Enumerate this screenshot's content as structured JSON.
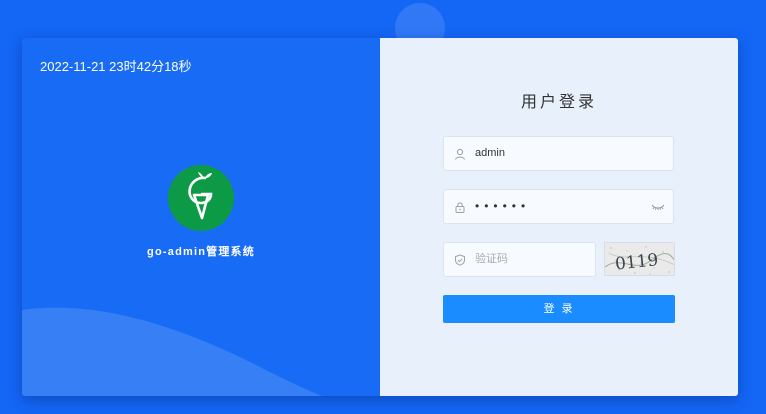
{
  "datetime": "2022-11-21 23时42分18秒",
  "app": {
    "title": "go-admin管理系统",
    "logo_icon": "carrot-g-logo-icon",
    "brand_color": "#0d9a47"
  },
  "login": {
    "title": "用户登录",
    "username": {
      "value": "admin",
      "icon": "user-icon"
    },
    "password": {
      "value": "••••••",
      "icon": "lock-icon",
      "toggle_icon": "eye-closed-icon"
    },
    "captcha": {
      "placeholder": "验证码",
      "icon": "shield-icon",
      "image_text": "0119"
    },
    "submit_label": "登 录"
  },
  "colors": {
    "background": "#1466f5",
    "left_panel": "#176bf4",
    "right_panel": "#e7f0fb",
    "button": "#1a8cff"
  }
}
